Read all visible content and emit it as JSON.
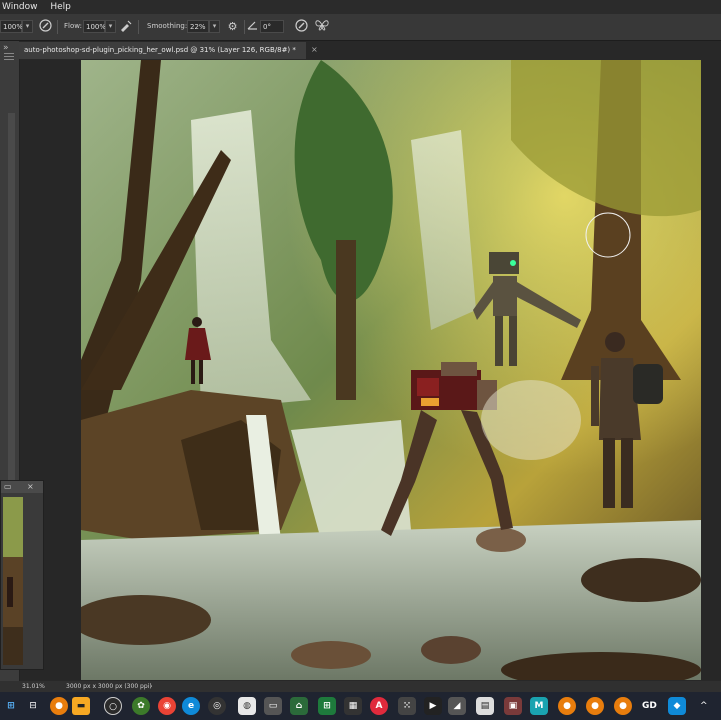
{
  "menu": {
    "items": [
      "Window",
      "Help"
    ]
  },
  "options": {
    "opacity_value": "100%",
    "flow_label": "Flow:",
    "flow_value": "100%",
    "smoothing_label": "Smoothing:",
    "smoothing_value": "22%",
    "angle_value": "0°"
  },
  "document": {
    "tab_title": "auto-photoshop-sd-plugin_picking_her_owl.psd @ 31% (Layer 126, RGB/8#) *",
    "close": "×"
  },
  "status": {
    "zoom": "31.01%",
    "doc_info": "3000 px x 3000 px (300 ppi)",
    "arrow": "›"
  },
  "panel": {
    "close": "×"
  },
  "taskbar": {
    "gd_label": "GD",
    "chevron": "^"
  },
  "colors": {
    "ui_dark": "#282828",
    "options_bg": "#383838",
    "taskbar_bg": "#1f2430",
    "forest_green": "#4a6a2a",
    "robot_red": "#8a2020",
    "robot_eye": "#3aff9a"
  },
  "icons": [
    "brush-icon",
    "gear-icon",
    "angle-icon",
    "butterfly-icon",
    "windows-start-icon",
    "search-icon",
    "task-view-icon"
  ]
}
